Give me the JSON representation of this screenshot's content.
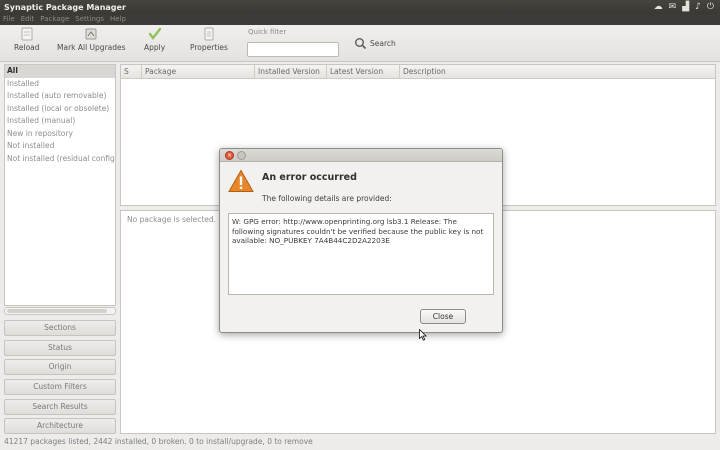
{
  "window": {
    "title": "Synaptic Package Manager"
  },
  "menu": [
    "File",
    "Edit",
    "Package",
    "Settings",
    "Help"
  ],
  "toolbar": {
    "reload": "Reload",
    "mark_all": "Mark All Upgrades",
    "apply": "Apply",
    "properties": "Properties",
    "quick_filter_label": "Quick filter",
    "quick_filter_value": "",
    "search": "Search"
  },
  "filters": {
    "items": [
      "All",
      "Installed",
      "Installed (auto removable)",
      "Installed (local or obsolete)",
      "Installed (manual)",
      "New in repository",
      "Not installed",
      "Not installed (residual config)"
    ],
    "selected_index": 0
  },
  "filter_buttons": [
    "Sections",
    "Status",
    "Origin",
    "Custom Filters",
    "Search Results",
    "Architecture"
  ],
  "table": {
    "columns": [
      "S",
      "Package",
      "Installed Version",
      "Latest Version",
      "Description"
    ]
  },
  "details": {
    "message": "No package is selected."
  },
  "status": {
    "text": "41217 packages listed, 2442 installed, 0 broken. 0 to install/upgrade, 0 to remove"
  },
  "dialog": {
    "heading": "An error occurred",
    "subheading": "The following details are provided:",
    "body": "W: GPG error: http://www.openprinting.org lsb3.1 Release: The following signatures couldn't be verified because the public key is not available: NO_PUBKEY 7A4B44C2D2A2203E",
    "close_label": "Close"
  },
  "colors": {
    "warning": "#e8872a",
    "close_button": "#e2573a",
    "panel": "#3c3b37"
  }
}
